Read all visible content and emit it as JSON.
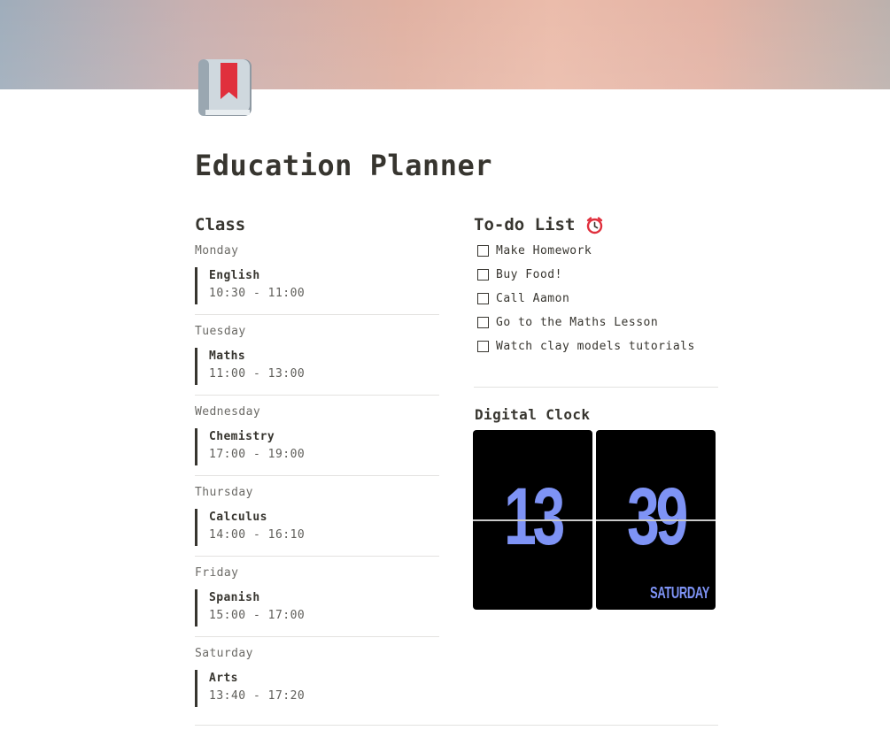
{
  "page": {
    "title": "Education Planner",
    "icon": "bookmark-book-icon"
  },
  "class_section": {
    "heading": "Class",
    "days": [
      {
        "day": "Monday",
        "subject": "English",
        "time": "10:30 - 11:00"
      },
      {
        "day": "Tuesday",
        "subject": "Maths",
        "time": "11:00 - 13:00"
      },
      {
        "day": "Wednesday",
        "subject": "Chemistry",
        "time": "17:00 - 19:00"
      },
      {
        "day": "Thursday",
        "subject": "Calculus",
        "time": "14:00 - 16:10"
      },
      {
        "day": "Friday",
        "subject": "Spanish",
        "time": "15:00 - 17:00"
      },
      {
        "day": "Saturday",
        "subject": "Arts",
        "time": "13:40 - 17:20"
      }
    ]
  },
  "todo_section": {
    "heading": "To-do List",
    "heading_icon": "alarm-clock-icon",
    "items": [
      {
        "label": "Make Homework",
        "checked": false
      },
      {
        "label": "Buy Food!",
        "checked": false
      },
      {
        "label": "Call Aamon",
        "checked": false
      },
      {
        "label": "Go to the Maths Lesson",
        "checked": false
      },
      {
        "label": "Watch clay models tutorials",
        "checked": false
      }
    ]
  },
  "clock_section": {
    "heading": "Digital Clock",
    "hours": "13",
    "minutes": "39",
    "weekday": "SATURDAY",
    "digit_color": "#7e93f5"
  },
  "colors": {
    "text": "#37352f",
    "divider": "#e3e2e0",
    "bookmark_red": "#e0303d"
  }
}
